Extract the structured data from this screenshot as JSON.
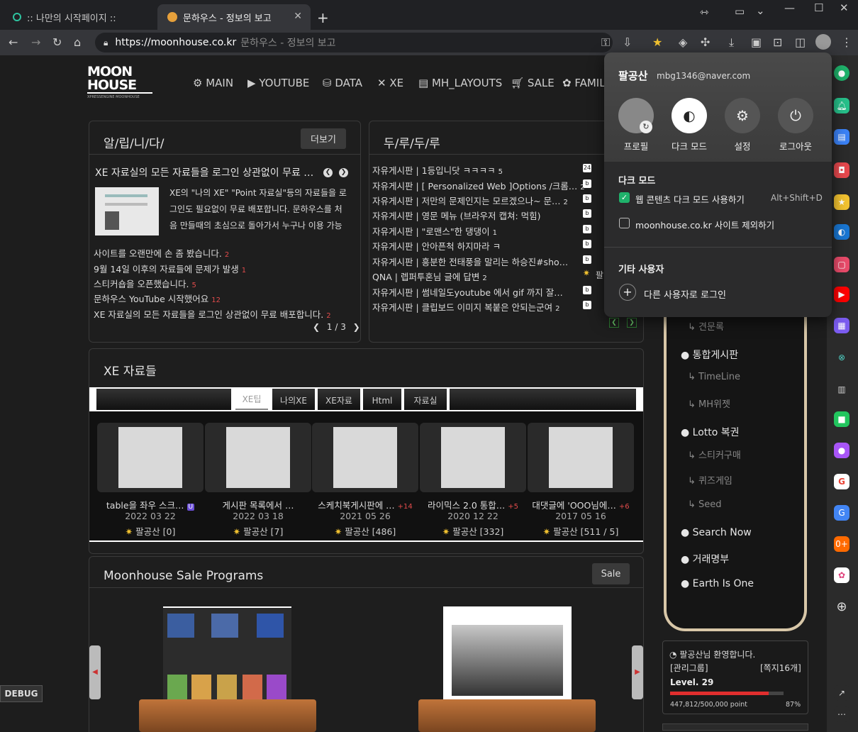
{
  "tabs": [
    {
      "title": ":: 나만의 시작페이지 ::"
    },
    {
      "title": "문하우스 - 정보의 보고"
    }
  ],
  "omnibox": {
    "url": "https://moonhouse.co.kr",
    "page_title": "문하우스 - 정보의 보고"
  },
  "site": {
    "logo_line1": "MOON",
    "logo_line2": "HOUSE",
    "logo_tag": "XPRESSENGINE MOONHOUSE",
    "nav": [
      "MAIN",
      "YOUTUBE",
      "DATA",
      "XE",
      "MH_LAYOUTS",
      "SALE",
      "FAMIL"
    ]
  },
  "notice": {
    "title": "알/립/니/다/",
    "more": "더보기",
    "headline": "XE 자료실의 모든 자료들을 로그인 상관없이 무료 …",
    "excerpt": [
      "XE의 \"나의 XE\" \"Point 자료실\"등의 자료들을 로",
      "그인도 필요없이 무료 배포합니다. 문하우스를 처",
      "음 만들때의 초심으로 돌아가서 누구나 이용 가능"
    ],
    "items": [
      {
        "text": "사이트를 오랜만에 손 좀 봤습니다.",
        "count": "2"
      },
      {
        "text": "9월 14일 이후의 자료들에 문제가 발생",
        "count": "1"
      },
      {
        "text": "스티커숍을 오픈했습니다.",
        "count": "5"
      },
      {
        "text": "문하우스 YouTube 시작했어요",
        "count": "12"
      },
      {
        "text": "XE 자료실의 모든 자료들을 로그인 상관없이 무료 배포합니다.",
        "count": "2"
      }
    ],
    "pager": "1 / 3"
  },
  "board": {
    "title": "두/루/두/루",
    "items": [
      {
        "text": "자유게시판 | 1등입니닷 ㅋㅋㅋㅋ",
        "count": "5"
      },
      {
        "text": "자유게시판 | [ Personalized Web ]Options /크롬…",
        "count": "2"
      },
      {
        "text": "자유게시판 | 저만의 문제인지는 모르겠으나~ 문…",
        "count": "2"
      },
      {
        "text": "자유게시판 | 영문 메뉴 (브라우저 캡쳐: 먹힘)",
        "count": ""
      },
      {
        "text": "자유게시판 | \"로맨스\"한 댕댕이",
        "count": "1"
      },
      {
        "text": "자유게시판 | 안아픈척 하지마라 ㅋ",
        "count": ""
      },
      {
        "text": "자유게시판 | 흥분한 전태풍을 말리는 하승진#sho…",
        "count": ""
      },
      {
        "text": "QNA | 렙퍼투혼님 글에 답변",
        "count": "2"
      },
      {
        "text": "자유게시판 | 썸네일도youtube 에서 gif 까지 잘…",
        "count": ""
      },
      {
        "text": "자유게시판 | 클립보드 이미지 복붙은 안되는군여",
        "count": "2"
      }
    ],
    "author_partial": "팔"
  },
  "xe": {
    "title": "XE 자료들",
    "tabs": [
      "XE팁",
      "나의XE",
      "XE자료",
      "Html",
      "자료실"
    ],
    "cards": [
      {
        "title": "table을 좌우 스크…",
        "badge": "U",
        "date": "2022 03 22",
        "author": "팔공산 [0]"
      },
      {
        "title": "게시판 목록에서 …",
        "badge": "",
        "date": "2022 03 18",
        "author": "팔공산 [7]"
      },
      {
        "title": "스케치북게시판에 …",
        "badge": "+14",
        "date": "2021 05 26",
        "author": "팔공산 [486]"
      },
      {
        "title": "라이믹스 2.0 통합…",
        "badge": "+5",
        "date": "2020 12 22",
        "author": "팔공산 [332]"
      },
      {
        "title": "대댓글에 'OOO님에…",
        "badge": "+6",
        "date": "2017 05 16",
        "author": "팔공산 [511 / 5]"
      }
    ]
  },
  "sale": {
    "title": "Moonhouse Sale Programs",
    "button": "Sale"
  },
  "side_menu": {
    "items": [
      {
        "text": "견문록",
        "sub": true
      },
      {
        "text": "통합게시판",
        "sub": false
      },
      {
        "text": "TimeLine",
        "sub": true
      },
      {
        "text": "MH위젯",
        "sub": true
      },
      {
        "text": "Lotto 복권",
        "sub": false
      },
      {
        "text": "스티커구매",
        "sub": true
      },
      {
        "text": "퀴즈게임",
        "sub": true
      },
      {
        "text": "Seed",
        "sub": true
      },
      {
        "text": "Search Now",
        "sub": false
      },
      {
        "text": "거래명부",
        "sub": false
      },
      {
        "text": "Earth Is One",
        "sub": false
      }
    ]
  },
  "user_box": {
    "welcome": "팔공산님 환영합니다.",
    "group": "[관리그룹]",
    "notes": "[쪽지16개]",
    "level": "Level. 29",
    "points": "447,812/500,000 point",
    "percent": "87%",
    "progress": 0.87
  },
  "debug": "DEBUG",
  "popup": {
    "name": "팔공산",
    "email": "mbg1346@naver.com",
    "buttons": [
      "프로필",
      "다크 모드",
      "설정",
      "로그아웃"
    ],
    "dark_section": "다크 모드",
    "opt1": "웹 콘텐츠 다크 모드 사용하기",
    "opt1_shortcut": "Alt+Shift+D",
    "opt1_checked": true,
    "opt2": "moonhouse.co.kr 사이트 제외하기",
    "opt2_checked": false,
    "other_section": "기타 사용자",
    "other_login": "다른 사용자로 로그인"
  },
  "colors": {
    "accent_green": "#1fb26b",
    "red": "#e04b4b"
  }
}
